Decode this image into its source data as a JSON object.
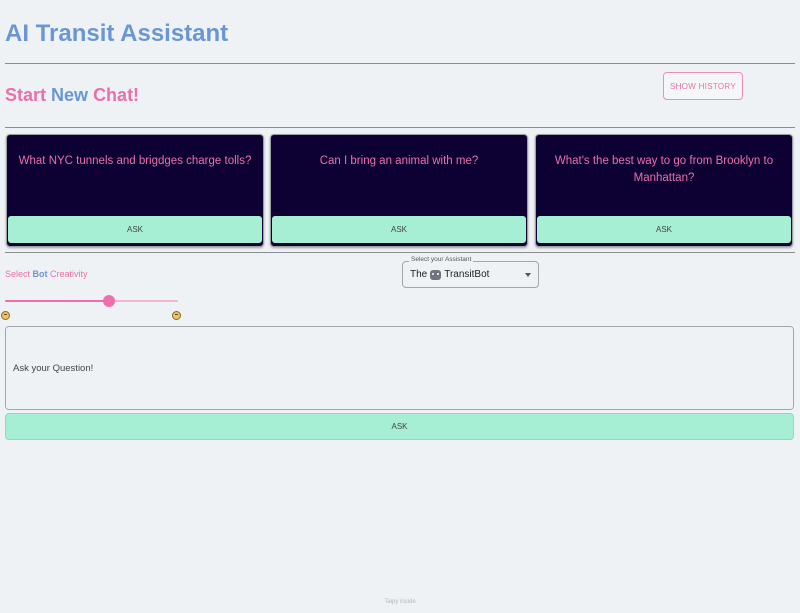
{
  "app": {
    "title": "AI Transit Assistant"
  },
  "header": {
    "new_chat": {
      "word1": "Start",
      "word2": "New",
      "word3": "Chat!"
    },
    "history_button": "SHOW HISTORY"
  },
  "cards": [
    {
      "question": "What NYC tunnels and brigdges charge tolls?",
      "button": "ASK"
    },
    {
      "question": "Can I bring an animal with me?",
      "button": "ASK"
    },
    {
      "question": "What's the best way to go from Brooklyn to Manhattan?",
      "button": "ASK"
    }
  ],
  "creativity": {
    "label_pre": "Select ",
    "label_bot": "Bot",
    "label_post": " Creativity",
    "value": 0.6
  },
  "assistant_select": {
    "legend": "Select your Assistant",
    "value_prefix": "The",
    "value_name": "TransitBot"
  },
  "question_input": {
    "placeholder": "Ask your Question!"
  },
  "ask_button": "ASK",
  "footer": "Taipy inside",
  "colors": {
    "pink": "#ec6fa9",
    "blue": "#6b96d4",
    "mint": "#a6efd4",
    "card_bg": "#0d0033"
  }
}
